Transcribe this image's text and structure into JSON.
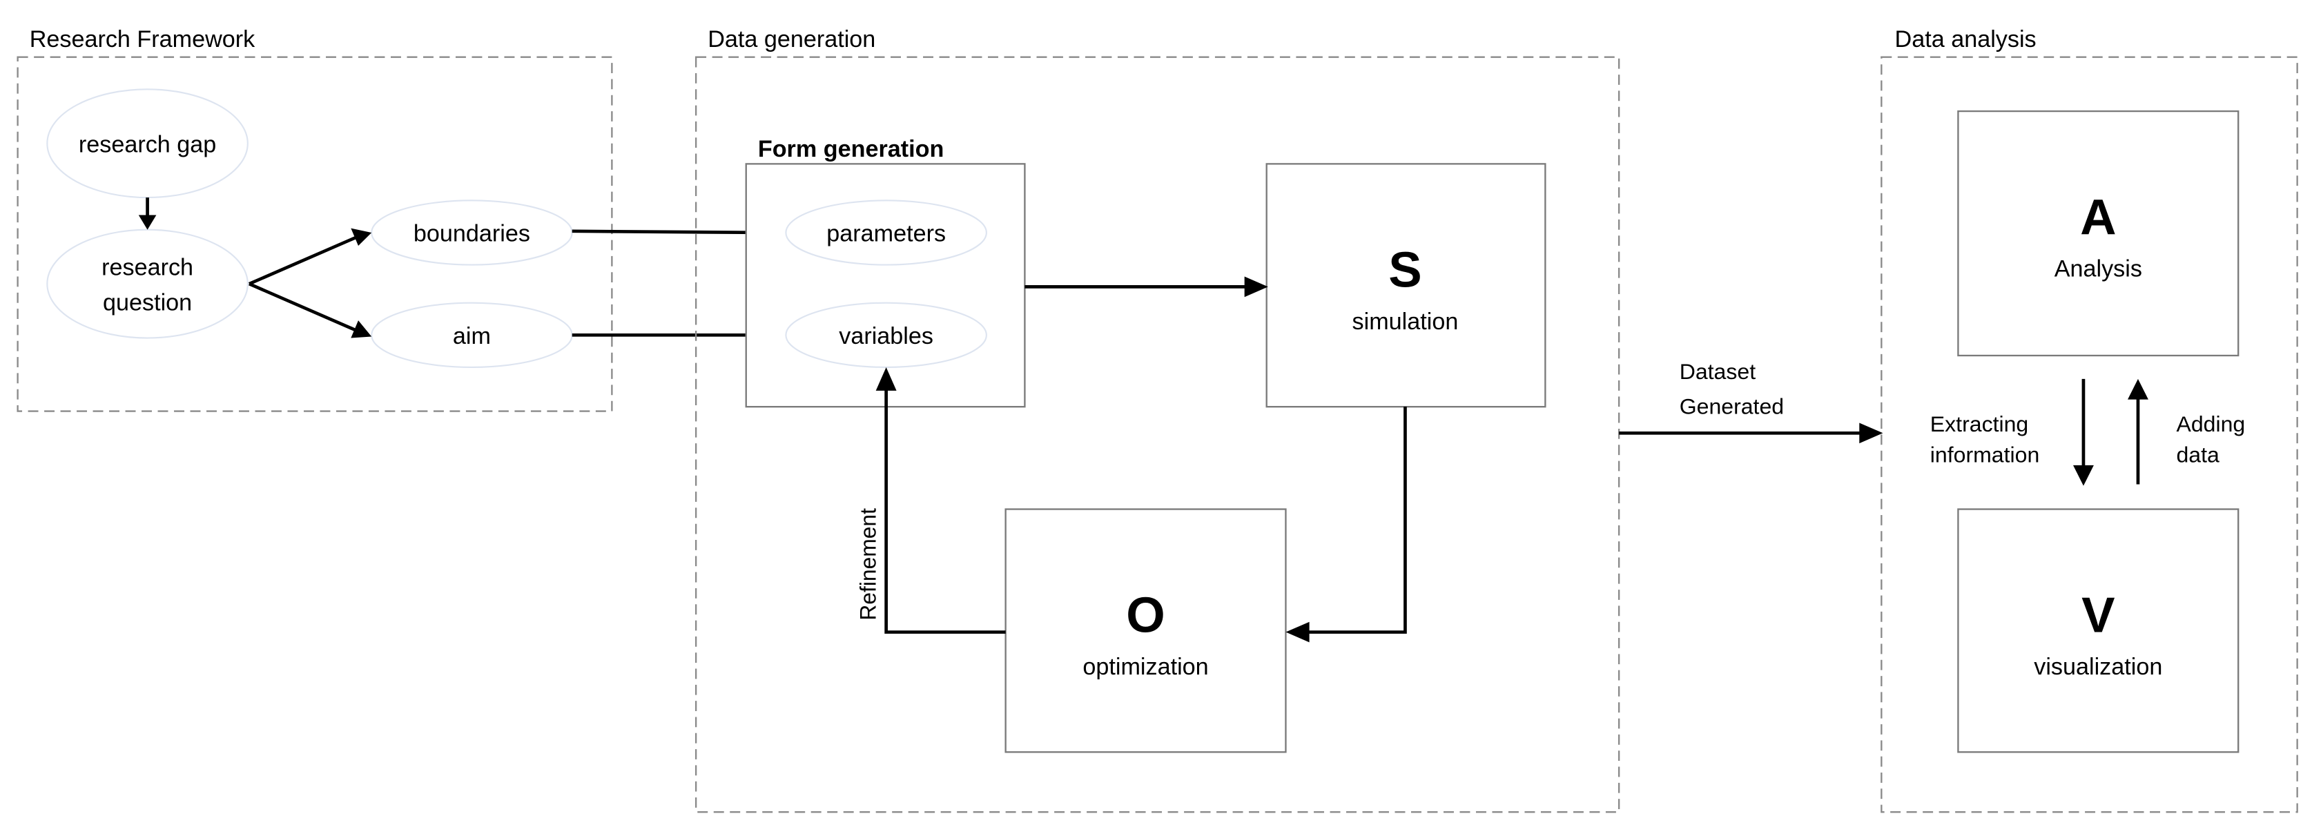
{
  "frames": {
    "research_framework": {
      "title": "Research Framework",
      "nodes": {
        "research_gap": "research gap",
        "research_question": [
          "research",
          "question"
        ],
        "boundaries": "boundaries",
        "aim": "aim"
      }
    },
    "data_generation": {
      "title": "Data generation",
      "form_generation": {
        "title": "Form generation",
        "parameters": "parameters",
        "variables": "variables"
      },
      "simulation": {
        "letter": "S",
        "label": "simulation"
      },
      "optimization": {
        "letter": "O",
        "label": "optimization"
      },
      "refinement_label": "Refinement"
    },
    "data_analysis": {
      "title": "Data analysis",
      "analysis": {
        "letter": "A",
        "label": "Analysis"
      },
      "visualization": {
        "letter": "V",
        "label": "visualization"
      },
      "extracting_label": [
        "Extracting",
        "information"
      ],
      "adding_label": [
        "Adding",
        "data"
      ]
    }
  },
  "dataset_label": [
    "Dataset",
    "Generated"
  ]
}
